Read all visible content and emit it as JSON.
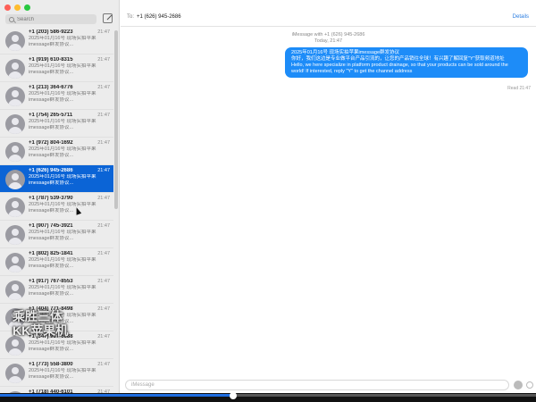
{
  "window": {
    "traffic_lights": [
      "close",
      "minimize",
      "zoom"
    ]
  },
  "sidebar": {
    "search_placeholder": "Search",
    "selected_index": 5,
    "conversations": [
      {
        "phone": "+1 (203) 586-9223",
        "time": "21:47",
        "line1": "2025年01月16号 现场实拍苹果",
        "line2": "imessage群发协议..."
      },
      {
        "phone": "+1 (919) 610-8315",
        "time": "21:47",
        "line1": "2025年01月16号 现场实拍苹果",
        "line2": "imessage群发协议..."
      },
      {
        "phone": "+1 (213) 364-6776",
        "time": "21:47",
        "line1": "2025年01月16号 现场实拍苹果",
        "line2": "imessage群发协议..."
      },
      {
        "phone": "+1 (754) 265-5711",
        "time": "21:47",
        "line1": "2025年01月16号 现场实拍苹果",
        "line2": "imessage群发协议..."
      },
      {
        "phone": "+1 (972) 804-1692",
        "time": "21:47",
        "line1": "2025年01月16号 现场实拍苹果",
        "line2": "imessage群发协议..."
      },
      {
        "phone": "+1 (626) 945-2686",
        "time": "21:47",
        "line1": "2025年01月16号 现场实拍苹果",
        "line2": "imessage群发协议..."
      },
      {
        "phone": "+1 (787) 539-3790",
        "time": "21:47",
        "line1": "2025年01月16号 现场实拍苹果",
        "line2": "imessage群发协议..."
      },
      {
        "phone": "+1 (907) 745-3921",
        "time": "21:47",
        "line1": "2025年01月16号 现场实拍苹果",
        "line2": "imessage群发协议..."
      },
      {
        "phone": "+1 (802) 825-1841",
        "time": "21:47",
        "line1": "2025年01月16号 现场实拍苹果",
        "line2": "imessage群发协议..."
      },
      {
        "phone": "+1 (917) 767-8553",
        "time": "21:47",
        "line1": "2025年01月16号 现场实拍苹果",
        "line2": "imessage群发协议..."
      },
      {
        "phone": "+1 (404) 771-8498",
        "time": "21:47",
        "line1": "2025年01月16号 现场实拍苹果",
        "line2": "imessage群发协议..."
      },
      {
        "phone": "+1 (347) 987-6688",
        "time": "21:47",
        "line1": "2025年01月16号 现场实拍苹果",
        "line2": "imessage群发协议..."
      },
      {
        "phone": "+1 (773) 558-3800",
        "time": "21:47",
        "line1": "2025年01月16号 现场实拍苹果",
        "line2": "imessage群发协议..."
      },
      {
        "phone": "+1 (718) 440-6101",
        "time": "21:47",
        "line1": "2025年01月16号 现场实拍苹果",
        "line2": "imessage群发协议..."
      }
    ]
  },
  "header": {
    "to_label": "To:",
    "to_number": "+1 (626) 945-2686",
    "details_label": "Details"
  },
  "conversation": {
    "service_line": "iMessage with +1 (626) 945-2686",
    "date_line": "Today, 21:47",
    "message_lines": [
      "2025年01月16号 现场实拍苹果imessage群发协议",
      "你好，我们这边是专业做平台产品引流的，让您的产品销往全球！有兴趣了解回复\"Y\"获取频道地址",
      "Hello, we here specialize in platform product drainage, so that your products can be sold around the world! If interested, reply \"Y\" to get the channel address"
    ],
    "read_receipt": "Read 21:47"
  },
  "composer": {
    "placeholder": "iMessage"
  },
  "watermark": {
    "line1": "乘胜三体",
    "line2": "KK苹果机"
  },
  "video": {
    "progress": 0.435
  },
  "colors": {
    "selected": "#0b64d6",
    "bubble": "#1d8cf8",
    "link": "#2a7de1"
  }
}
